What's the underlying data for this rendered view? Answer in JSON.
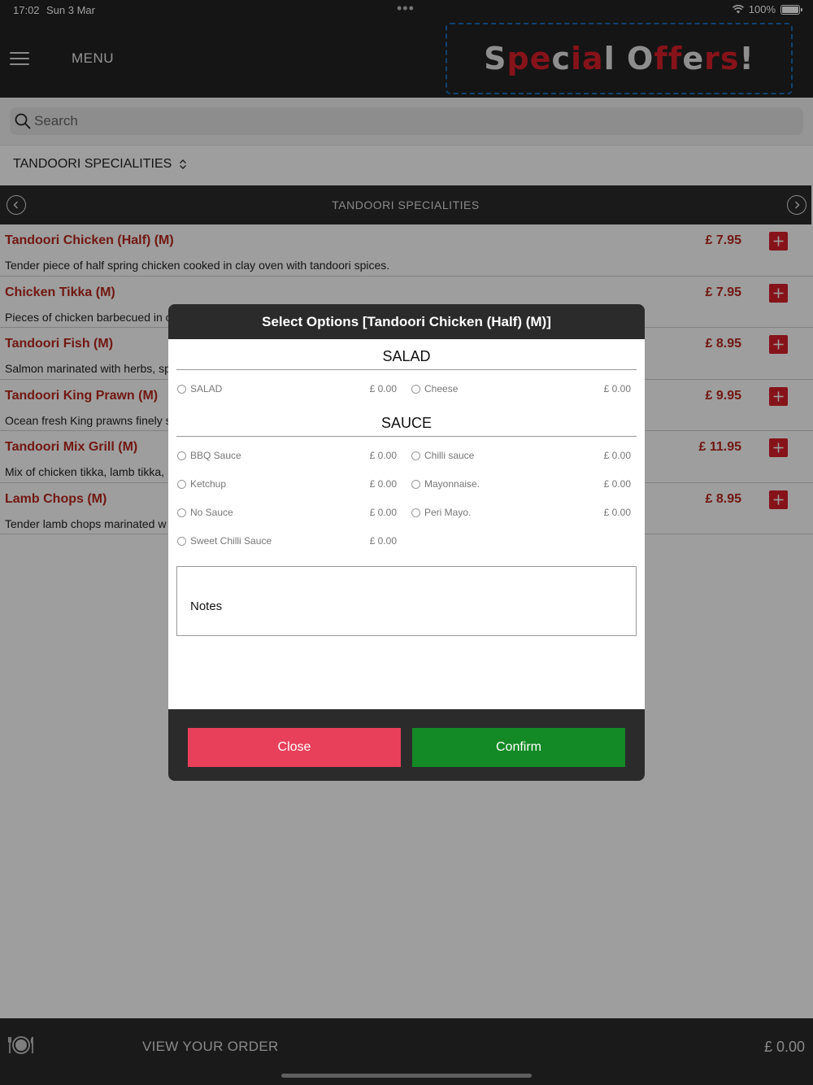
{
  "status_bar": {
    "time": "17:02",
    "date": "Sun 3 Mar",
    "dots": "•••",
    "battery": "100%"
  },
  "header": {
    "menu_label": "MENU",
    "offers_parts": [
      {
        "t": "S",
        "c": "w"
      },
      {
        "t": "pe",
        "c": "r"
      },
      {
        "t": "c",
        "c": "w"
      },
      {
        "t": "ia",
        "c": "r"
      },
      {
        "t": "l ",
        "c": "w"
      },
      {
        "t": "O",
        "c": "w"
      },
      {
        "t": "ff",
        "c": "r"
      },
      {
        "t": "e",
        "c": "w"
      },
      {
        "t": "rs",
        "c": "r"
      },
      {
        "t": "!",
        "c": "w"
      }
    ]
  },
  "search": {
    "placeholder": "Search"
  },
  "category": {
    "selected": "TANDOORI SPECIALITIES",
    "nav_title": "TANDOORI SPECIALITIES"
  },
  "menu_items": [
    {
      "name": "Tandoori Chicken (Half) (M)",
      "price": "£ 7.95",
      "desc": "Tender piece of half spring chicken cooked  in clay oven with tandoori spices."
    },
    {
      "name": "Chicken Tikka (M)",
      "price": "£ 7.95",
      "desc": "Pieces of chicken barbecued in c"
    },
    {
      "name": "Tandoori Fish (M)",
      "price": "£ 8.95",
      "desc": "Salmon marinated with herbs, sp"
    },
    {
      "name": "Tandoori King Prawn (M)",
      "price": "£ 9.95",
      "desc": "Ocean fresh King prawns finely s"
    },
    {
      "name": "Tandoori Mix Grill (M)",
      "price": "£ 11.95",
      "desc": "Mix of chicken tikka, lamb tikka, "
    },
    {
      "name": "Lamb Chops (M)",
      "price": "£ 8.95",
      "desc": "Tender lamb chops marinated w"
    }
  ],
  "modal": {
    "title": "Select Options [Tandoori Chicken (Half) (M)]",
    "groups": [
      {
        "title": "SALAD",
        "options": [
          {
            "label": "SALAD",
            "price": "£ 0.00"
          },
          {
            "label": "Cheese",
            "price": "£ 0.00"
          }
        ]
      },
      {
        "title": "SAUCE",
        "options": [
          {
            "label": "BBQ Sauce",
            "price": "£ 0.00"
          },
          {
            "label": "Chilli sauce",
            "price": "£ 0.00"
          },
          {
            "label": "Ketchup",
            "price": "£ 0.00"
          },
          {
            "label": "Mayonnaise.",
            "price": "£ 0.00"
          },
          {
            "label": "No Sauce",
            "price": "£ 0.00"
          },
          {
            "label": "Peri Mayo.",
            "price": "£ 0.00"
          },
          {
            "label": "Sweet Chilli Sauce",
            "price": "£ 0.00"
          }
        ]
      }
    ],
    "notes_placeholder": "Notes",
    "close_label": "Close",
    "confirm_label": "Confirm"
  },
  "footer": {
    "order_label": "VIEW YOUR ORDER",
    "total": "£ 0.00"
  }
}
